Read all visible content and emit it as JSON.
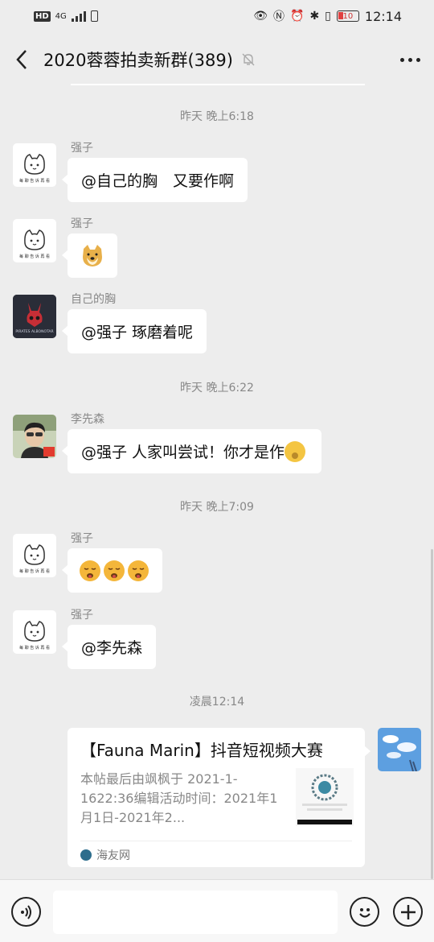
{
  "status_bar": {
    "hd": "HD",
    "network": "4G",
    "battery": "10",
    "time": "12:14"
  },
  "header": {
    "title": "2020蓉蓉拍卖新群(389)",
    "back_icon": "chevron-left-icon",
    "mute_icon": "bell-off-icon",
    "more_icon": "more-dots-icon"
  },
  "messages": {
    "time1": "昨天 晚上6:18",
    "m1_sender": "强子",
    "m1_text": "@自己的胸　又要作啊",
    "m2_sender": "强子",
    "m3_sender": "自己的胸",
    "m3_text": "@强子  琢磨着呢",
    "time2": "昨天 晚上6:22",
    "m4_sender": "李先森",
    "m4_text": "@强子  人家叫尝试！你才是作",
    "time3": "昨天 晚上7:09",
    "m5_sender": "强子",
    "m6_sender": "强子",
    "m6_text": "@李先森",
    "time4": "凌晨12:14"
  },
  "card": {
    "title": "【Fauna Marin】抖音短视频大赛",
    "desc": "本帖最后由飒枫于 2021-1-1622:36编辑活动时间：2021年1月1日-2021年2...",
    "source": "海友网"
  },
  "avatars": {
    "qiangzi_caption": "每 聊 告 诉 再 看",
    "pirates_caption": "PIRATES ALBONOTAR"
  },
  "colors": {
    "background": "#ededed",
    "bubble": "#ffffff",
    "time_text": "#888888"
  }
}
